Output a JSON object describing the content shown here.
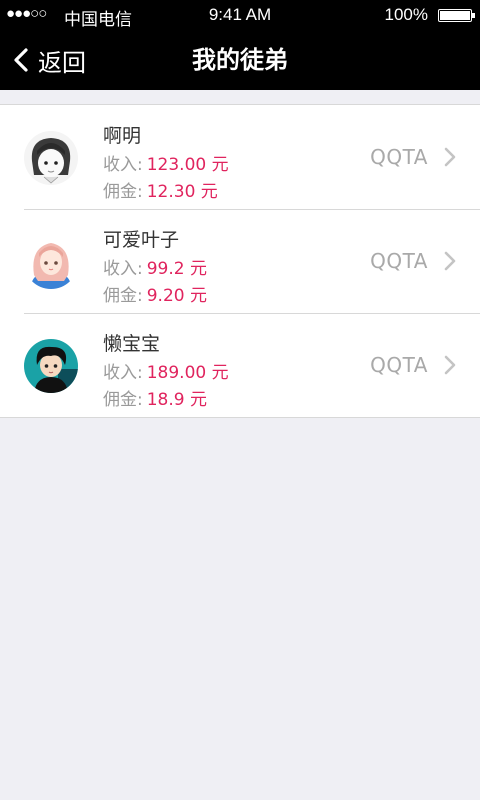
{
  "status_bar": {
    "signal": "●●●○○",
    "carrier": "中国电信",
    "time": "9:41 AM",
    "battery": "100%"
  },
  "nav": {
    "back_label": "返回",
    "title": "我的徒弟"
  },
  "apprentices": [
    {
      "name": "啊明",
      "income_label": "收入:",
      "income_value": "123.00 元",
      "commission_label": "佣金:",
      "commission_value": "12.30 元",
      "tag": "QQTA"
    },
    {
      "name": "可爱叶子",
      "income_label": "收入:",
      "income_value": "99.2 元",
      "commission_label": "佣金:",
      "commission_value": "9.20 元",
      "tag": "QQTA"
    },
    {
      "name": "懒宝宝",
      "income_label": "收入:",
      "income_value": "189.00 元",
      "commission_label": "佣金:",
      "commission_value": "18.9 元",
      "tag": "QQTA"
    }
  ],
  "colors": {
    "value_red": "#e0245e",
    "bar_bg": "#000000",
    "page_bg": "#efeff4"
  }
}
